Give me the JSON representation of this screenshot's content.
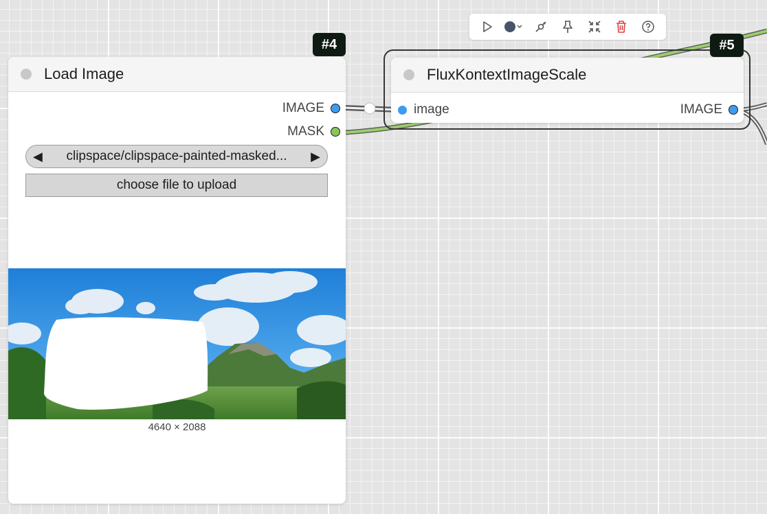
{
  "toolbar": {
    "icons": [
      "run-icon",
      "color-icon",
      "bypass-icon",
      "pin-icon",
      "collapse-icon",
      "delete-icon",
      "help-icon"
    ],
    "delete_color": "#e04040"
  },
  "nodes": [
    {
      "id": "#4",
      "title": "Load Image",
      "outputs": [
        {
          "label": "IMAGE",
          "color": "#3d9bf0"
        },
        {
          "label": "MASK",
          "color": "#8ac65a"
        }
      ],
      "image_combo": {
        "value": "clipspace/clipspace-painted-masked..."
      },
      "upload_label": "choose file to upload",
      "preview_size": "4640 × 2088"
    },
    {
      "id": "#5",
      "title": "FluxKontextImageScale",
      "inputs": [
        {
          "label": "image",
          "color": "#3d9bf0"
        }
      ],
      "outputs": [
        {
          "label": "IMAGE",
          "color": "#3d9bf0"
        }
      ]
    }
  ],
  "colors": {
    "image_link": "#3d9bf0",
    "mask_link": "#8ac65a",
    "badge_bg": "#0f1b12",
    "canvas_bg": "#e4e4e4"
  }
}
